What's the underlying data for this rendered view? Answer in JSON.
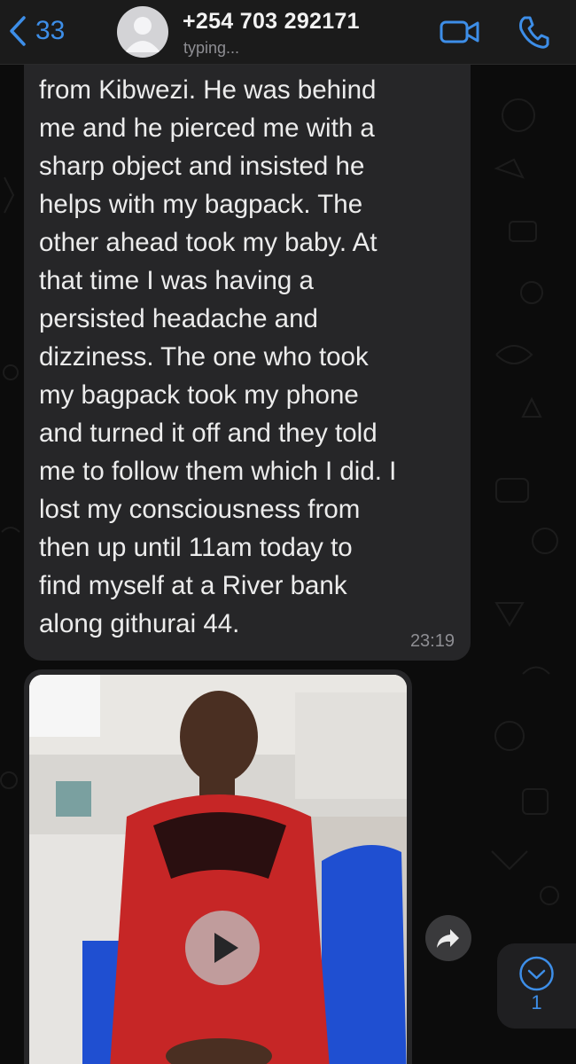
{
  "header": {
    "back_count": "33",
    "contact_name": "+254 703 292171",
    "status": "typing...",
    "accent_color": "#3d8ee8",
    "icons": [
      "chevron-left-icon",
      "avatar-placeholder-icon",
      "video-camera-icon",
      "phone-icon"
    ]
  },
  "messages": [
    {
      "type": "text",
      "text": "from Kibwezi. He was behind\nme and he pierced me with a\nsharp object and insisted he\nhelps with my bagpack. The\nother ahead took my baby. At\nthat time I was having a\npersisted headache and\ndizziness. The one who took\nmy bagpack took my phone\nand turned it off and they told\nme to follow them which I did. I\nlost my consciousness from\nthen up until 11am today to\nfind myself at a River bank\nalong githurai 44.",
      "time": "23:19"
    },
    {
      "type": "video",
      "icons": [
        "play-icon",
        "share-forward-icon"
      ]
    }
  ],
  "scroll_down": {
    "icon": "chevron-down-icon",
    "unread_count": "1"
  }
}
